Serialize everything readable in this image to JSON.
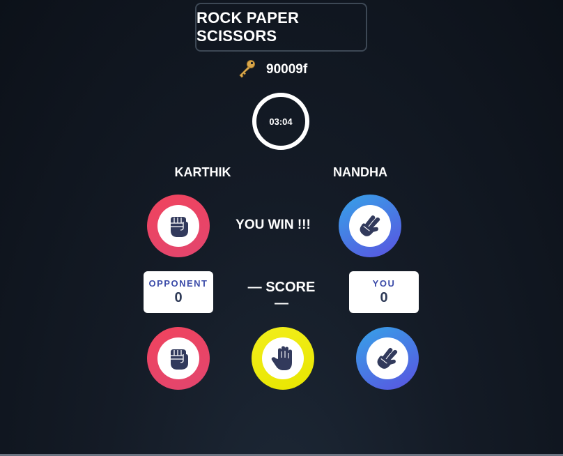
{
  "header": {
    "title": "ROCK PAPER SCISSORS"
  },
  "room": {
    "icon": "key-icon",
    "code": "90009f"
  },
  "timer": {
    "value": "03:04"
  },
  "players": {
    "left_name": "KARTHIK",
    "right_name": "NANDHA"
  },
  "round": {
    "result_text": "YOU WIN !!!",
    "opponent_choice": "rock",
    "your_choice": "scissors"
  },
  "score": {
    "heading": "— SCORE —",
    "opponent_label": "OPPONENT",
    "opponent_value": "0",
    "you_label": "YOU",
    "you_value": "0"
  },
  "choices": [
    {
      "name": "rock",
      "icon": "fist-icon",
      "color": "#ee4462"
    },
    {
      "name": "paper",
      "icon": "open-hand-icon",
      "color": "#f0ec14"
    },
    {
      "name": "scissors",
      "icon": "peace-hand-icon",
      "color": "#4a7ae6"
    }
  ],
  "colors": {
    "icon": "#323a5c",
    "score_label": "#3b4ba8"
  }
}
